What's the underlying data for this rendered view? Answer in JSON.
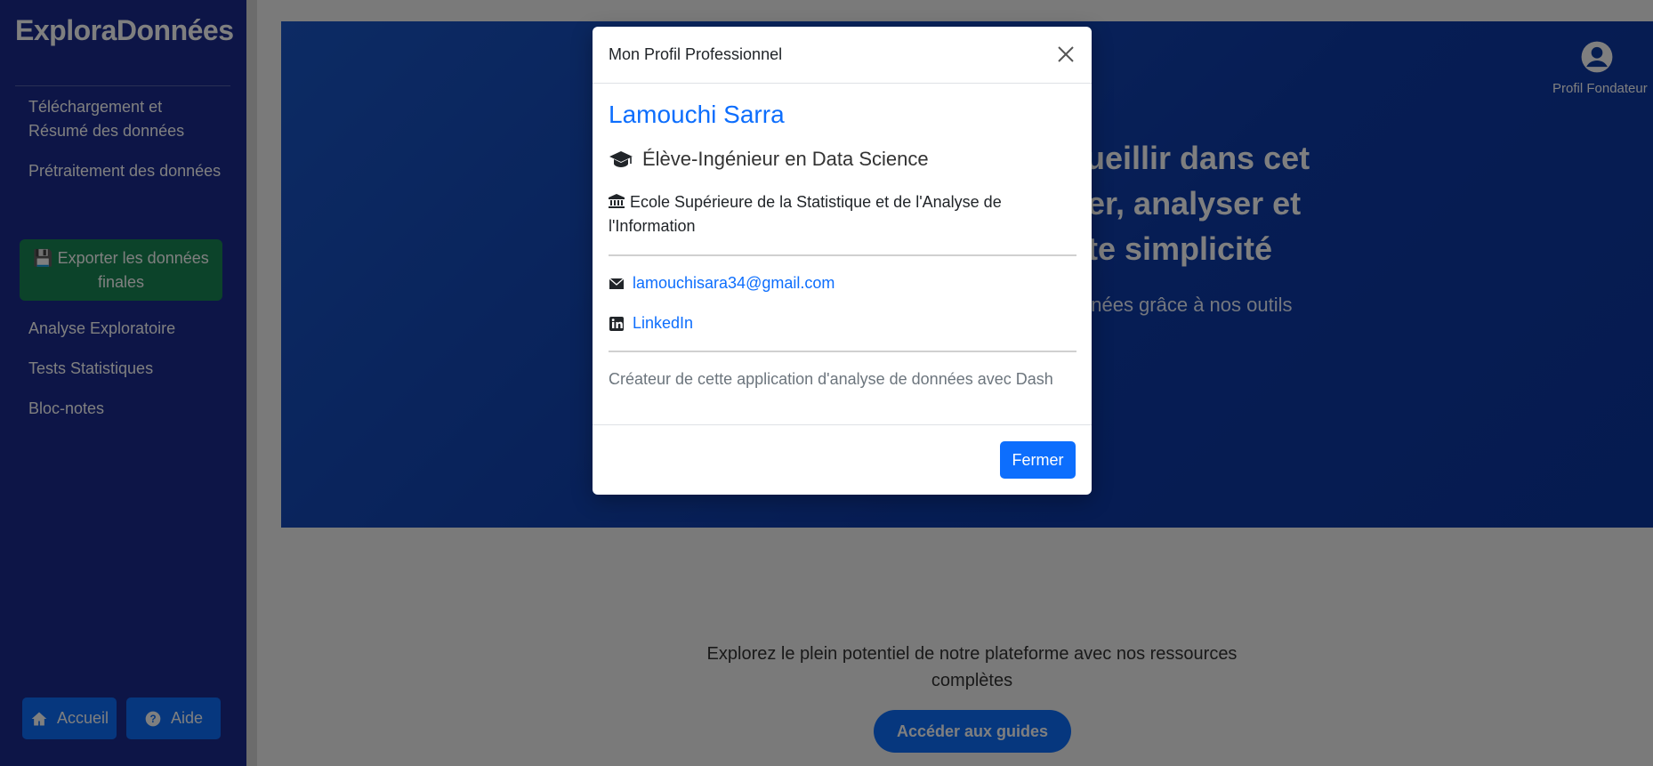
{
  "sidebar": {
    "brand": "ExploraDonnées",
    "items": [
      {
        "label": "Téléchargement et Résumé des données"
      },
      {
        "label": "Prétraitement des données"
      },
      {
        "label": "Analyse Exploratoire"
      },
      {
        "label": "Tests Statistiques"
      },
      {
        "label": "Bloc-notes"
      }
    ],
    "export_label": "💾 Exporter les données finales",
    "home_label": "Accueil",
    "help_label": "Aide"
  },
  "hero": {
    "title_line1": "cueillir dans cet",
    "title_line2": "orer, analyser et",
    "title_line3": "ute simplicité",
    "subtitle": "nnées grâce à nos outils",
    "profile_label": "Profil Fondateur"
  },
  "main": {
    "explore_text": "Explorez le plein potentiel de notre plateforme avec nos ressources complètes",
    "guides_label": "Accéder aux guides"
  },
  "modal": {
    "title": "Mon Profil Professionnel",
    "name": "Lamouchi Sarra",
    "role": "Élève-Ingénieur en Data Science",
    "school": "Ecole Supérieure de la Statistique et de l'Analyse de l'Information",
    "email": "lamouchisara34@gmail.com",
    "linkedin": "LinkedIn",
    "description": "Créateur de cette application d'analyse de données avec Dash",
    "close_label": "Fermer"
  },
  "colors": {
    "sidebar": "#1a2b8f",
    "primary": "#0d6efd",
    "success": "#198754",
    "hero": "#0d3aa8"
  }
}
